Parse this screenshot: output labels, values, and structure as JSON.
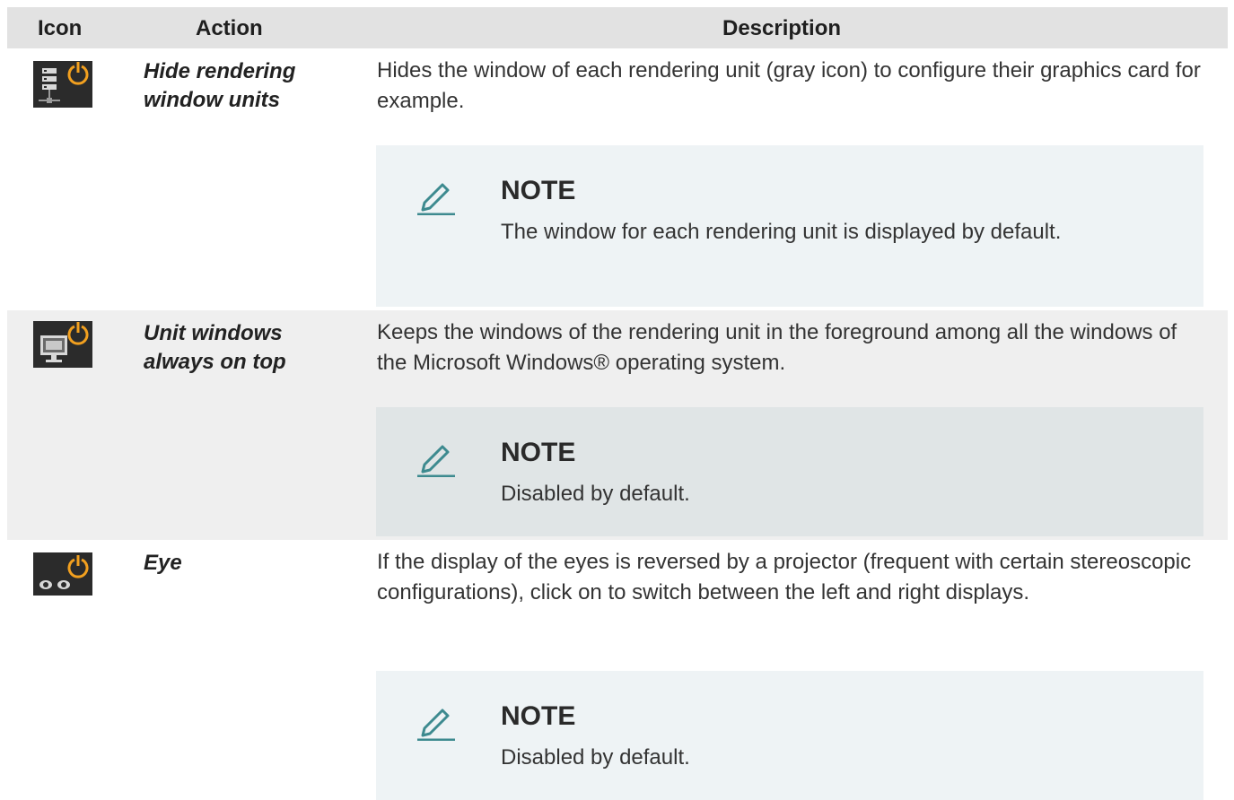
{
  "header": {
    "icon": "Icon",
    "action": "Action",
    "description": "Description"
  },
  "rows": [
    {
      "icon_name": "rendering-units-power-icon",
      "action": "Hide rendering window units",
      "description": "Hides the window of each rendering unit (gray icon) to configure their graphics card for example.",
      "note": {
        "title": "NOTE",
        "text": "The window for each rendering unit is displayed by default."
      }
    },
    {
      "icon_name": "monitor-power-icon",
      "action": "Unit windows always on top",
      "description": "Keeps the windows of the rendering unit in the foreground among all the windows of the Microsoft Windows® operating system.",
      "note": {
        "title": "NOTE",
        "text": "Disabled by default."
      }
    },
    {
      "icon_name": "eyes-power-icon",
      "action": "Eye",
      "description": "If the display of the eyes is reversed by a projector (frequent with certain stereoscopic configurations), click on to switch between the left and right displays.",
      "note": {
        "title": "NOTE",
        "text": "Disabled by default."
      }
    }
  ],
  "colors": {
    "power_orange": "#f2a01f",
    "icon_bg": "#2b2b2b",
    "note_accent": "#3d8a8f",
    "header_bg": "#e2e2e2",
    "alt_row_bg": "#efefef",
    "note_bg": "#eef3f5"
  }
}
